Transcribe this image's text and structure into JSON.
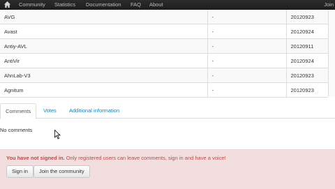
{
  "nav": {
    "items": [
      "Community",
      "Statistics",
      "Documentation",
      "FAQ",
      "About"
    ],
    "right": "Join"
  },
  "rows": [
    {
      "name": "AVG",
      "result": "-",
      "date": "20120923"
    },
    {
      "name": "Avast",
      "result": "-",
      "date": "20120924"
    },
    {
      "name": "Antiy-AVL",
      "result": "-",
      "date": "20120911"
    },
    {
      "name": "AntiVir",
      "result": "-",
      "date": "20120924"
    },
    {
      "name": "AhnLab-V3",
      "result": "-",
      "date": "20120923"
    },
    {
      "name": "Agnitum",
      "result": "-",
      "date": "20120923"
    }
  ],
  "tabs": [
    "Comments",
    "Votes",
    "Additional information"
  ],
  "comments": {
    "empty": "No comments"
  },
  "alert": {
    "bold": "You have not signed in.",
    "text": " Only registered users can leave comments, sign in and have a voice!"
  },
  "buttons": {
    "signin": "Sign in",
    "join": "Join the community"
  },
  "colors": {
    "link": "#0088cc",
    "alert_bg": "#f2dede",
    "alert_text": "#b94a48",
    "navbar": "#222222"
  }
}
